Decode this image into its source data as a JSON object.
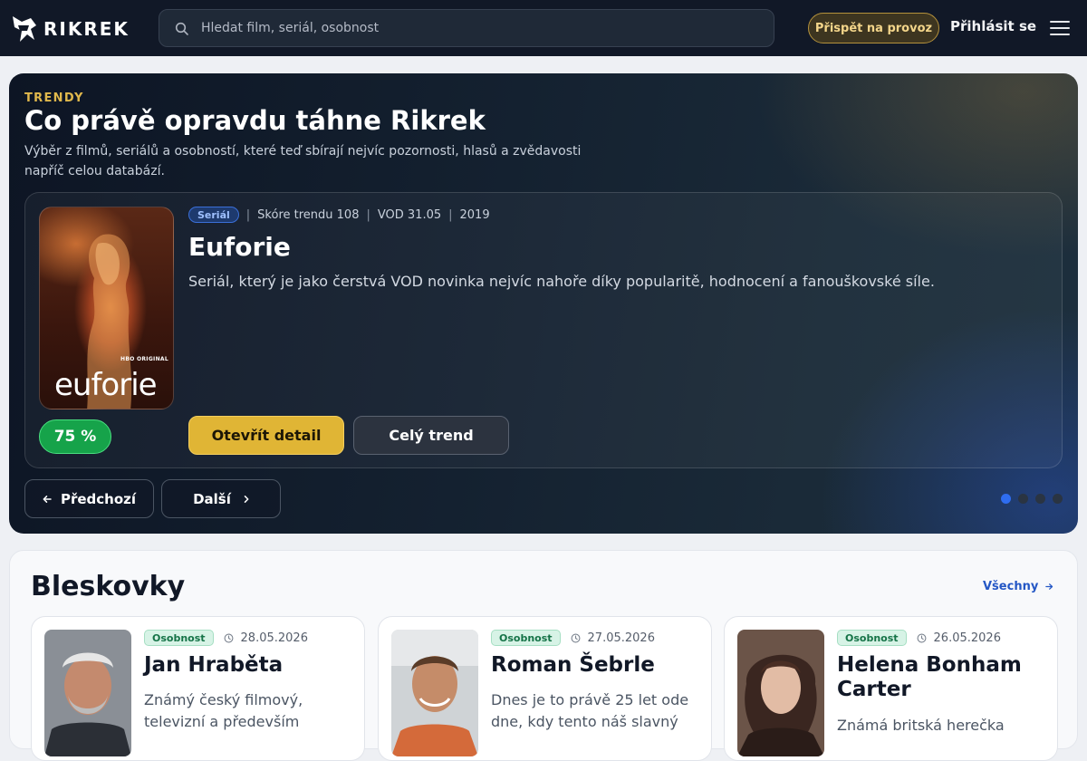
{
  "header": {
    "logo_text": "RIKREK",
    "search_placeholder": "Hledat film, seriál, osobnost",
    "support_label": "Přispět na provoz",
    "login_label": "Přihlásit se"
  },
  "hero": {
    "eyebrow": "TRENDY",
    "title": "Co právě opravdu táhne Rikrek",
    "description": "Výběr z filmů, seriálů a osobností, které teď sbírají nejvíc pozornosti, hlasů a zvědavosti napříč celou databází.",
    "featured": {
      "poster_brand": "HBO ORIGINAL",
      "poster_title": "euforie",
      "score": "75 %",
      "type": "Seriál",
      "trend_score": "Skóre trendu 108",
      "vod": "VOD 31.05",
      "year": "2019",
      "title": "Euforie",
      "description": "Seriál, který je jako čerstvá VOD novinka nejvíc nahoře díky popularitě, hodnocení a fanouškovské síle.",
      "primary_label": "Otevřít detail",
      "secondary_label": "Celý trend"
    },
    "prev_label": "Předchozí",
    "next_label": "Další",
    "slides_total": 4,
    "slide_active": 1
  },
  "news": {
    "title": "Bleskovky",
    "all_label": "Všechny",
    "items": [
      {
        "tag": "Osobnost",
        "date": "28.05.2026",
        "name": "Jan Hraběta",
        "text": "Známý český filmový, televizní a především"
      },
      {
        "tag": "Osobnost",
        "date": "27.05.2026",
        "name": "Roman Šebrle",
        "text": "Dnes je to právě 25 let ode dne, kdy tento náš slavný"
      },
      {
        "tag": "Osobnost",
        "date": "26.05.2026",
        "name": "Helena Bonham Carter",
        "text": "Známá britská herečka"
      }
    ]
  },
  "colors": {
    "topbar": "#111827",
    "accent_gold": "#e0b535",
    "score_green": "#16a34a",
    "link_blue": "#2457c5",
    "dot_active": "#2f6df0"
  }
}
